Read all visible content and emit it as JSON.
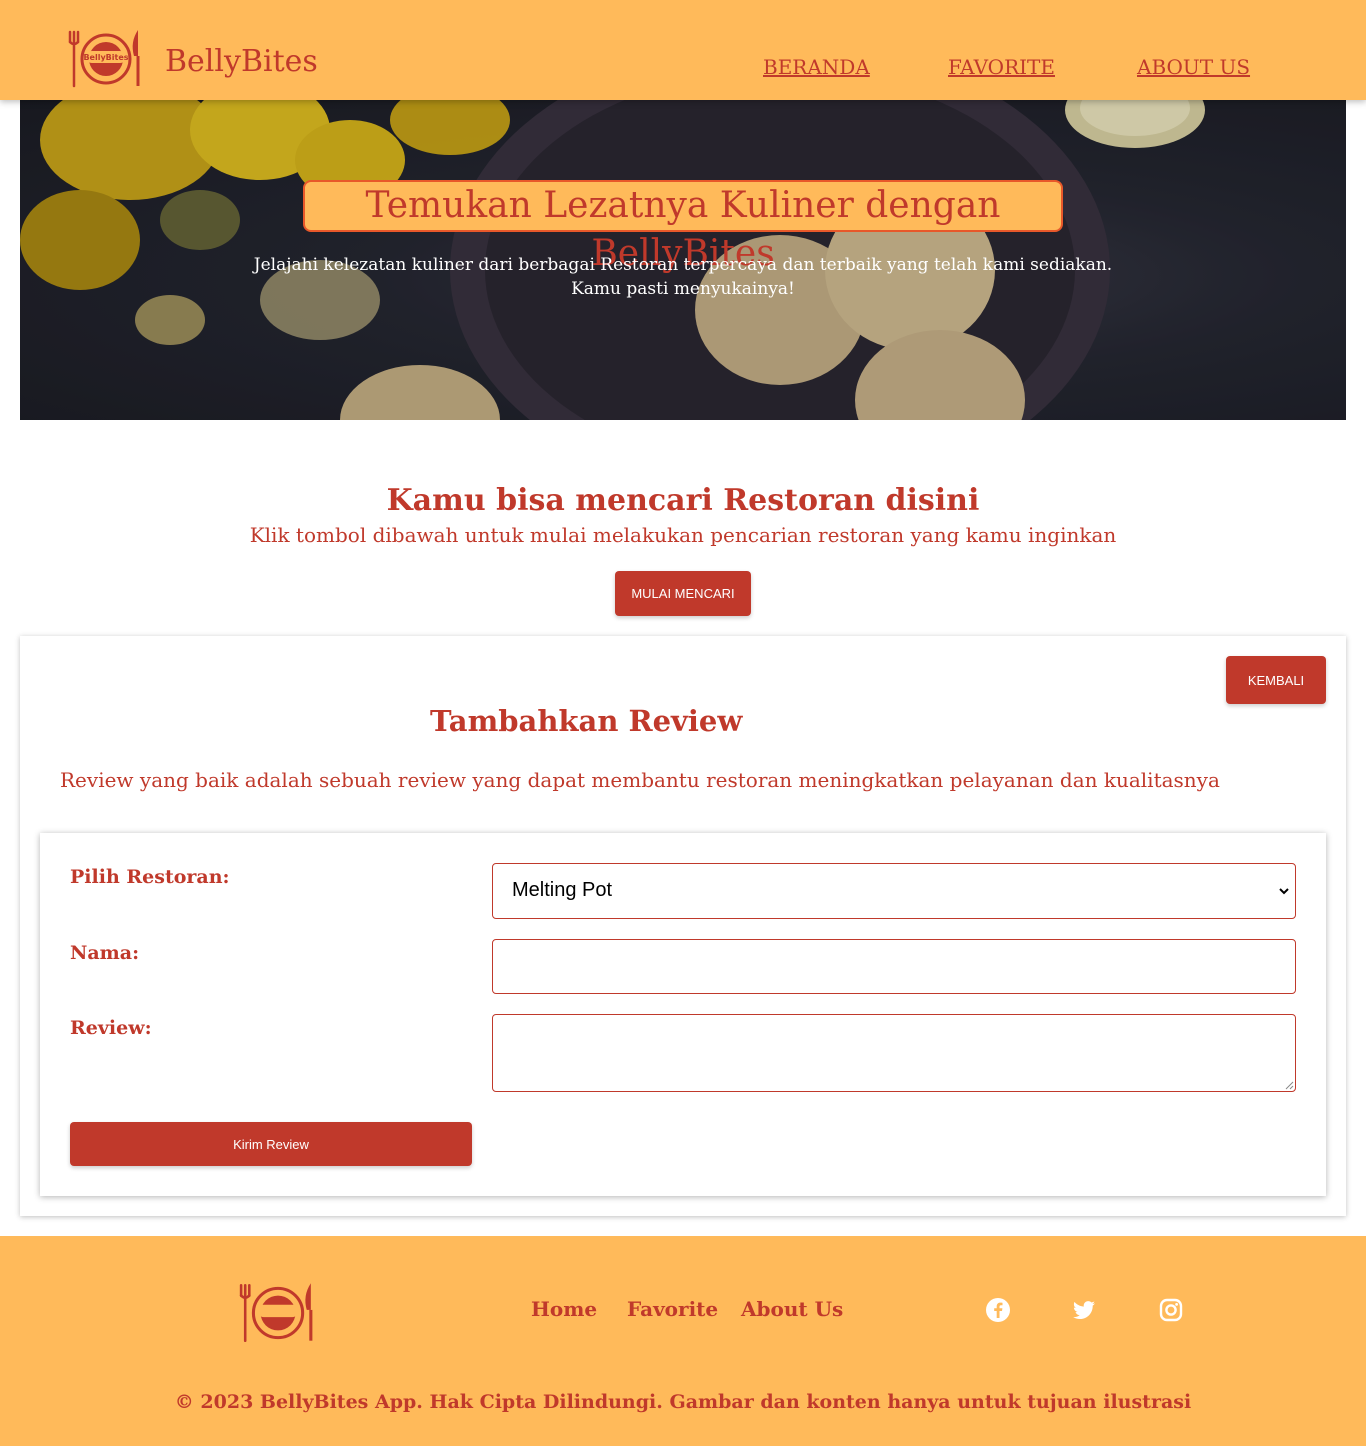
{
  "header": {
    "brand": "BellyBites",
    "logo_text": "BellyBites",
    "nav": [
      "BERANDA",
      "FAVORITE",
      "ABOUT US"
    ]
  },
  "hero": {
    "title": "Temukan Lezatnya Kuliner dengan BellyBites",
    "subtitle_line1": "Jelajahi kelezatan kuliner dari berbagai Restoran terpercaya dan terbaik yang telah kami sediakan.",
    "subtitle_line2": "Kamu pasti menyukainya!"
  },
  "search": {
    "title": "Kamu bisa mencari Restoran disini",
    "subtitle": "Klik tombol dibawah untuk mulai melakukan pencarian restoran yang kamu inginkan",
    "button": "MULAI MENCARI"
  },
  "review": {
    "back_button": "KEMBALI",
    "title": "Tambahkan Review",
    "description": "Review yang baik adalah sebuah review yang dapat membantu restoran meningkatkan pelayanan dan kualitasnya",
    "restaurant_label": "Pilih Restoran:",
    "restaurant_selected": "Melting Pot",
    "name_label": "Nama:",
    "name_value": "",
    "review_label": "Review:",
    "review_value": "",
    "submit": "Kirim Review"
  },
  "footer": {
    "links": [
      "Home",
      "Favorite",
      "About Us"
    ],
    "social": [
      "facebook-icon",
      "twitter-icon",
      "instagram-icon"
    ],
    "copyright": "© 2023 BellyBites App. Hak Cipta Dilindungi. Gambar dan konten hanya untuk tujuan ilustrasi"
  },
  "colors": {
    "accent": "#FFBA5A",
    "primary": "#C0392B"
  }
}
